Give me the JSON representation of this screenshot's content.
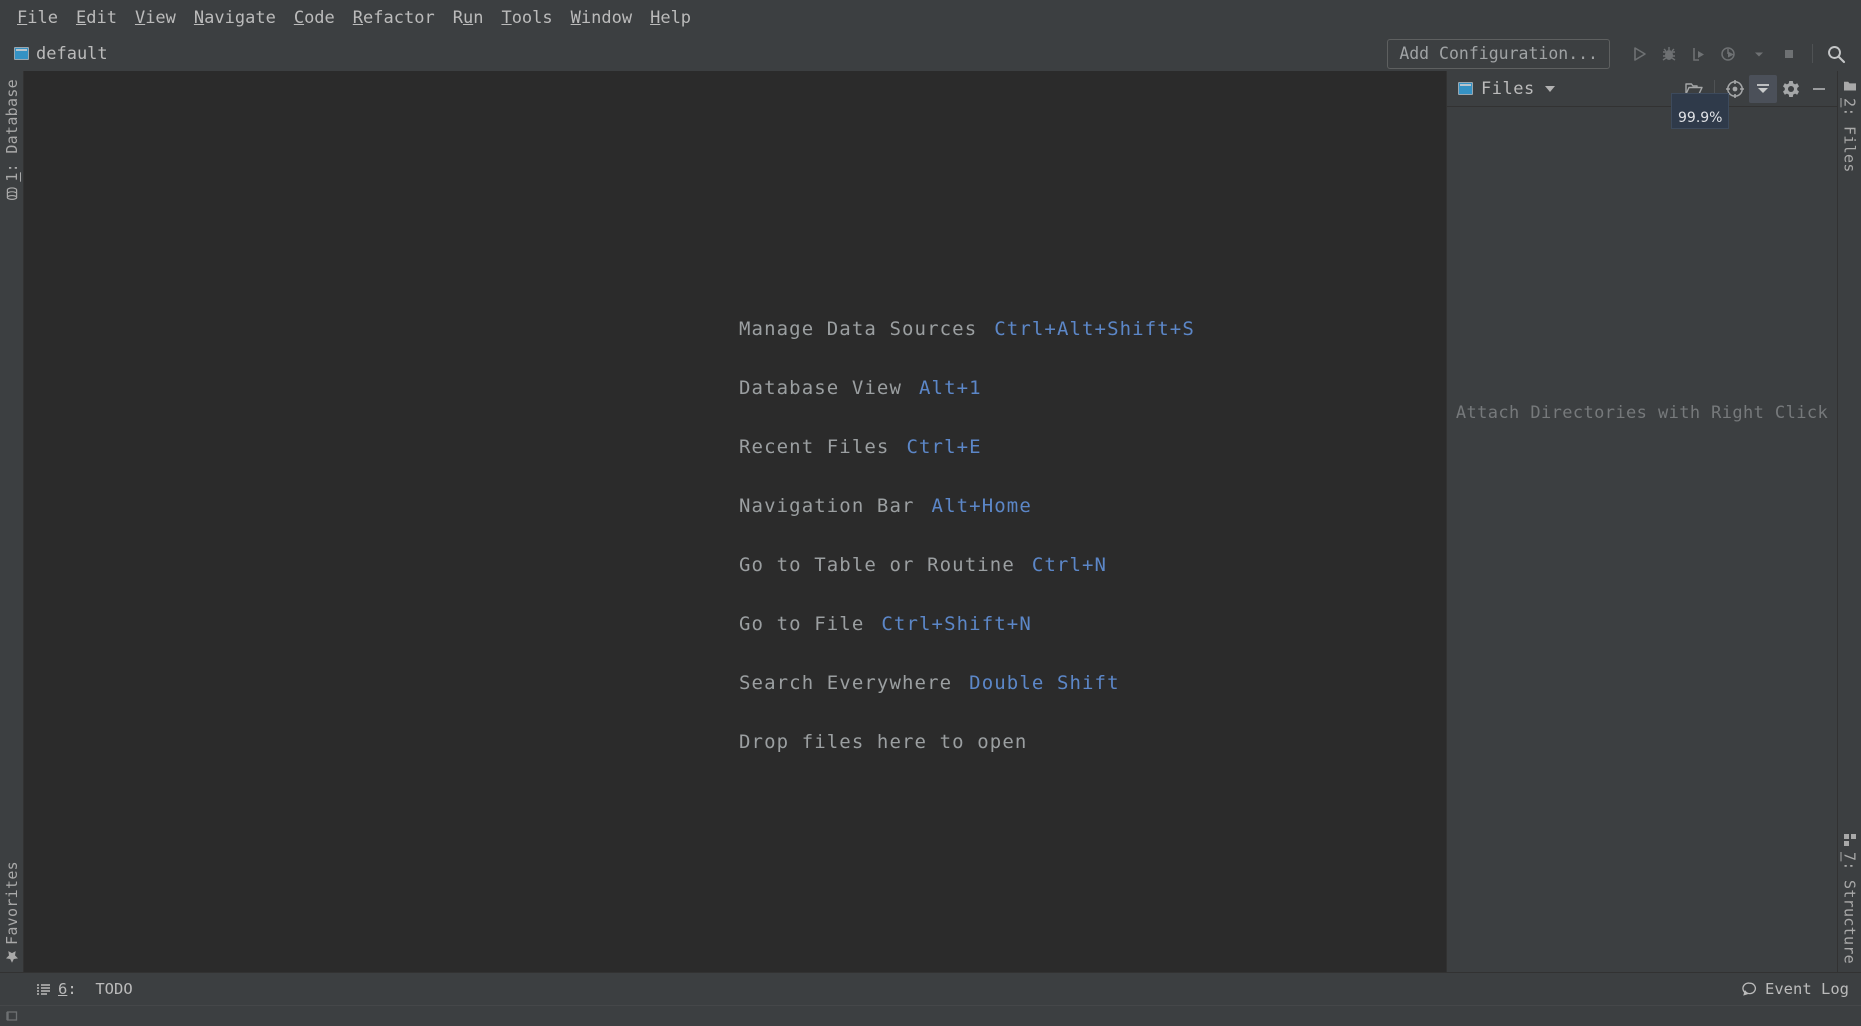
{
  "window": {
    "title": "default"
  },
  "menubar": {
    "items": [
      {
        "label": "File",
        "mnemonic": "F"
      },
      {
        "label": "Edit",
        "mnemonic": "E"
      },
      {
        "label": "View",
        "mnemonic": "V"
      },
      {
        "label": "Navigate",
        "mnemonic": "N"
      },
      {
        "label": "Code",
        "mnemonic": "C"
      },
      {
        "label": "Refactor",
        "mnemonic": "R"
      },
      {
        "label": "Run",
        "mnemonic": "u"
      },
      {
        "label": "Tools",
        "mnemonic": "T"
      },
      {
        "label": "Window",
        "mnemonic": "W"
      },
      {
        "label": "Help",
        "mnemonic": "H"
      }
    ]
  },
  "navbar": {
    "project_name": "default",
    "project_icon": "monitor-icon",
    "add_configuration_label": "Add Configuration...",
    "buttons": [
      {
        "name": "run-button",
        "icon": "run-icon",
        "enabled": false
      },
      {
        "name": "debug-button",
        "icon": "debug-icon",
        "enabled": false
      },
      {
        "name": "run-coverage-button",
        "icon": "coverage-icon",
        "enabled": false
      },
      {
        "name": "profile-button",
        "icon": "profile-icon",
        "enabled": false
      },
      {
        "name": "profile-dropdown",
        "icon": "chevron-down-icon",
        "enabled": false
      },
      {
        "name": "stop-button",
        "icon": "stop-icon",
        "enabled": false
      },
      {
        "name": "search-button",
        "icon": "search-icon",
        "enabled": true
      }
    ]
  },
  "left_stripe": {
    "top": [
      {
        "label": "1: Database",
        "mnemonic": "1",
        "icon": "database-icon",
        "name": "tool-tab-database"
      }
    ],
    "bottom": [
      {
        "label": "Favorites",
        "icon": "star-icon",
        "name": "tool-tab-favorites"
      }
    ]
  },
  "right_stripe": {
    "top": [
      {
        "label": "2: Files",
        "mnemonic": "2",
        "icon": "folder-icon",
        "name": "tool-tab-files"
      }
    ],
    "bottom": [
      {
        "label": "7: Structure",
        "mnemonic": "7",
        "icon": "structure-icon",
        "name": "tool-tab-structure"
      }
    ]
  },
  "editor": {
    "tips": [
      {
        "action": "Manage Data Sources",
        "shortcut": "Ctrl+Alt+Shift+S"
      },
      {
        "action": "Database View",
        "shortcut": "Alt+1"
      },
      {
        "action": "Recent Files",
        "shortcut": "Ctrl+E"
      },
      {
        "action": "Navigation Bar",
        "shortcut": "Alt+Home"
      },
      {
        "action": "Go to Table or Routine",
        "shortcut": "Ctrl+N"
      },
      {
        "action": "Go to File",
        "shortcut": "Ctrl+Shift+N"
      },
      {
        "action": "Search Everywhere",
        "shortcut": "Double Shift"
      },
      {
        "action": "Drop files here to open",
        "shortcut": ""
      }
    ],
    "background_color": "#2b2b2b",
    "action_color": "#9b9fa1",
    "shortcut_color": "#5c87c8"
  },
  "files_panel": {
    "title": "Files",
    "title_icon": "monitor-icon",
    "empty_message": "Attach Directories with Right Click",
    "tooltip_badge": "99.9%",
    "actions": [
      {
        "name": "open-folder-button",
        "icon": "open-folder-icon",
        "active": false
      },
      {
        "name": "scroll-from-source-button",
        "icon": "target-icon",
        "active": false
      },
      {
        "name": "collapse-all-button",
        "icon": "collapse-all-icon",
        "active": true
      },
      {
        "name": "settings-button",
        "icon": "gear-icon",
        "active": false
      },
      {
        "name": "hide-button",
        "icon": "minimize-icon",
        "active": false
      }
    ]
  },
  "statusbar": {
    "left": {
      "label": "6: TODO",
      "mnemonic": "6",
      "icon": "todo-list-icon"
    },
    "right": {
      "label": "Event Log",
      "icon": "event-log-icon"
    }
  },
  "colors": {
    "panel_bg": "#3c3f41",
    "editor_bg": "#2b2b2b",
    "text": "#bbbbbb",
    "accent_blue": "#5c87c8",
    "badge_bg": "#2f3a4a",
    "highlight": "#4b5059"
  }
}
